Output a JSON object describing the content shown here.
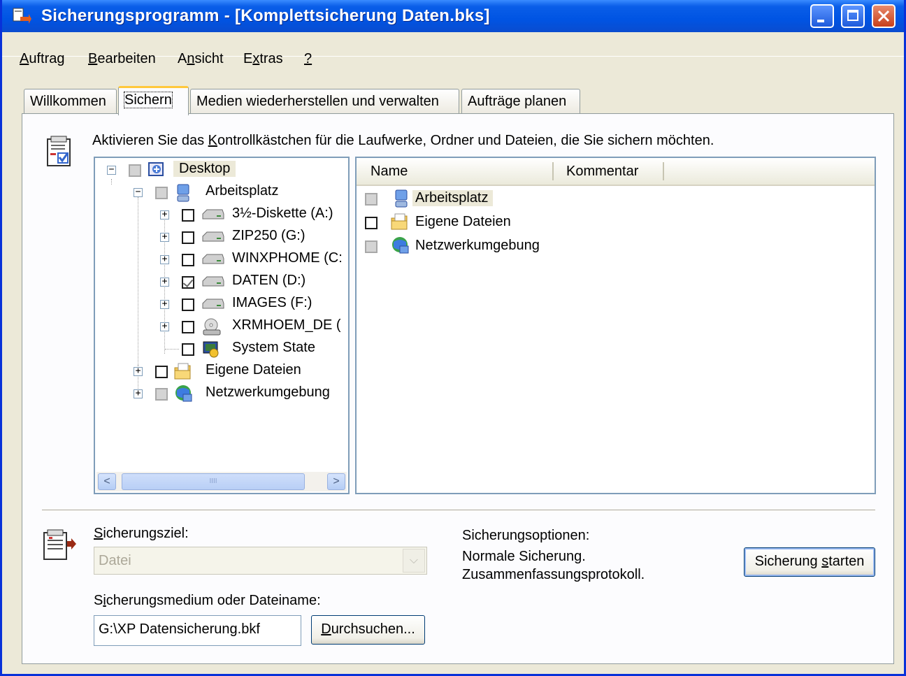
{
  "window": {
    "title": "Sicherungsprogramm - [Komplettsicherung Daten.bks]"
  },
  "menu": [
    {
      "pre": "",
      "u": "A",
      "post": "uftrag"
    },
    {
      "pre": "",
      "u": "B",
      "post": "earbeiten"
    },
    {
      "pre": "A",
      "u": "n",
      "post": "sicht"
    },
    {
      "pre": "E",
      "u": "x",
      "post": "tras"
    },
    {
      "pre": "",
      "u": "?",
      "post": ""
    }
  ],
  "tabs": [
    "Willkommen",
    "Sichern",
    "Medien wiederherstellen und verwalten",
    "Aufträge planen"
  ],
  "active_tab": "Sichern",
  "instruction": {
    "pre": "Aktivieren Sie das ",
    "u": "K",
    "post": "ontrollkästchen für die Laufwerke, Ordner und Dateien, die Sie sichern möchten."
  },
  "tree": {
    "desktop": "Desktop",
    "arbeitsplatz": "Arbeitsplatz",
    "drives": [
      {
        "label": "3½-Diskette (A:)",
        "checked": false
      },
      {
        "label": "ZIP250 (G:)",
        "checked": false
      },
      {
        "label": "WINXPHOME (C:",
        "checked": false
      },
      {
        "label": "DATEN (D:)",
        "checked": true
      },
      {
        "label": "IMAGES (F:)",
        "checked": false
      },
      {
        "label": "XRMHOEM_DE (",
        "checked": false
      },
      {
        "label": "System State",
        "checked": false
      }
    ],
    "eigene": "Eigene Dateien",
    "netz": "Netzwerkumgebung",
    "scroll_grip": "IIII"
  },
  "list": {
    "columns": [
      "Name",
      "Kommentar"
    ],
    "rows": [
      "Arbeitsplatz",
      "Eigene Dateien",
      "Netzwerkumgebung"
    ]
  },
  "ziel": {
    "label_u": "S",
    "label_rest": "icherungsziel:",
    "value": "Datei"
  },
  "medium": {
    "label_pre": "S",
    "label_u": "i",
    "label_rest": "cherungsmedium oder Dateiname:",
    "value": "G:\\XP Datensicherung.bkf"
  },
  "browse": {
    "u": "D",
    "rest": "urchsuchen..."
  },
  "options": {
    "title": "Sicherungsoptionen:",
    "line1": "Normale Sicherung.",
    "line2": "Zusammenfassungsprotokoll."
  },
  "start": {
    "pre": "Sicherung ",
    "u": "s",
    "post": "tarten"
  },
  "colors": {
    "titlebar": "#0054e3",
    "face": "#ece9d8"
  }
}
